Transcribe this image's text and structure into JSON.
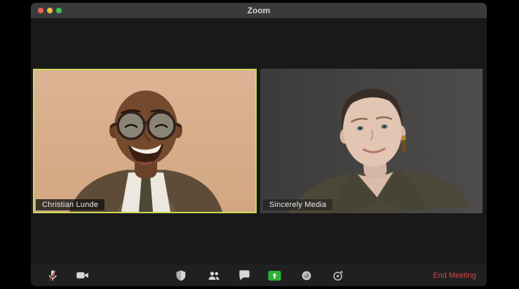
{
  "window": {
    "title": "Zoom",
    "traffic_lights": [
      "close",
      "minimize",
      "zoom"
    ]
  },
  "tiles": [
    {
      "name": "Christian Lunde",
      "active_speaker": true
    },
    {
      "name": "Sincerely Media",
      "active_speaker": false
    }
  ],
  "toolbar": {
    "icons": [
      "microphone-muted-icon",
      "video-camera-icon",
      "security-shield-icon",
      "participants-icon",
      "chat-bubble-icon",
      "share-screen-icon",
      "record-icon",
      "stopwatch-icon"
    ],
    "end_meeting": "End Meeting"
  },
  "colors": {
    "active_speaker_border": "#c9d957",
    "share_screen_green": "#2fb039",
    "end_meeting_red": "#cd4944",
    "titlebar": "#3a3a3c"
  }
}
